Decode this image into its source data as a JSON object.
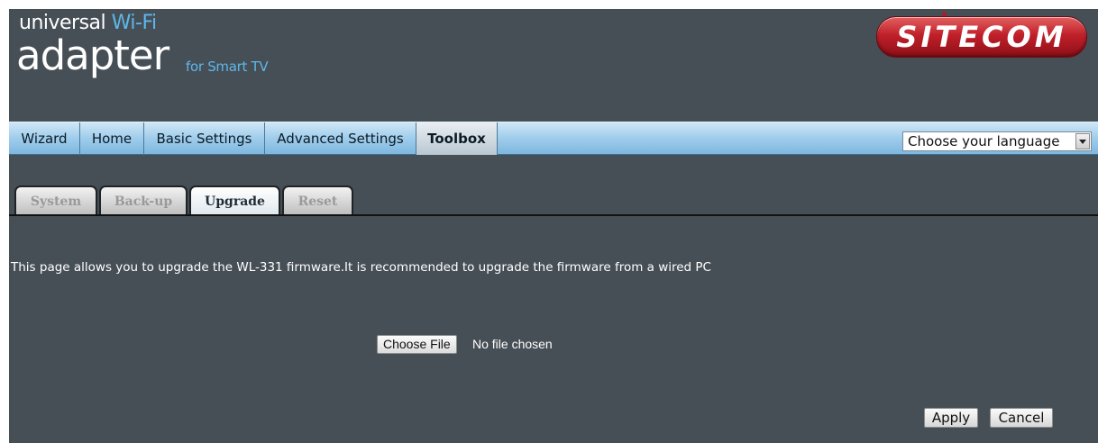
{
  "header": {
    "brand_prefix": "universal",
    "brand_highlight": "Wi-Fi",
    "brand_main": "adapter",
    "brand_sub": "for Smart TV",
    "logo_text": "SITECOM"
  },
  "nav": {
    "items": [
      {
        "label": "Wizard"
      },
      {
        "label": "Home"
      },
      {
        "label": "Basic Settings"
      },
      {
        "label": "Advanced Settings"
      },
      {
        "label": "Toolbox",
        "active": true
      }
    ],
    "language_select": "Choose your language"
  },
  "subtabs": [
    {
      "label": "System"
    },
    {
      "label": "Back-up"
    },
    {
      "label": "Upgrade",
      "active": true
    },
    {
      "label": "Reset"
    }
  ],
  "content": {
    "description": "This page allows you to upgrade the WL-331 firmware.It is recommended to upgrade the firmware from a wired PC",
    "file_button": "Choose File",
    "file_status": "No file chosen",
    "apply_button": "Apply",
    "cancel_button": "Cancel"
  },
  "colors": {
    "background": "#474f56",
    "accent": "#5cb7ea",
    "logo_red": "#c0202a"
  }
}
